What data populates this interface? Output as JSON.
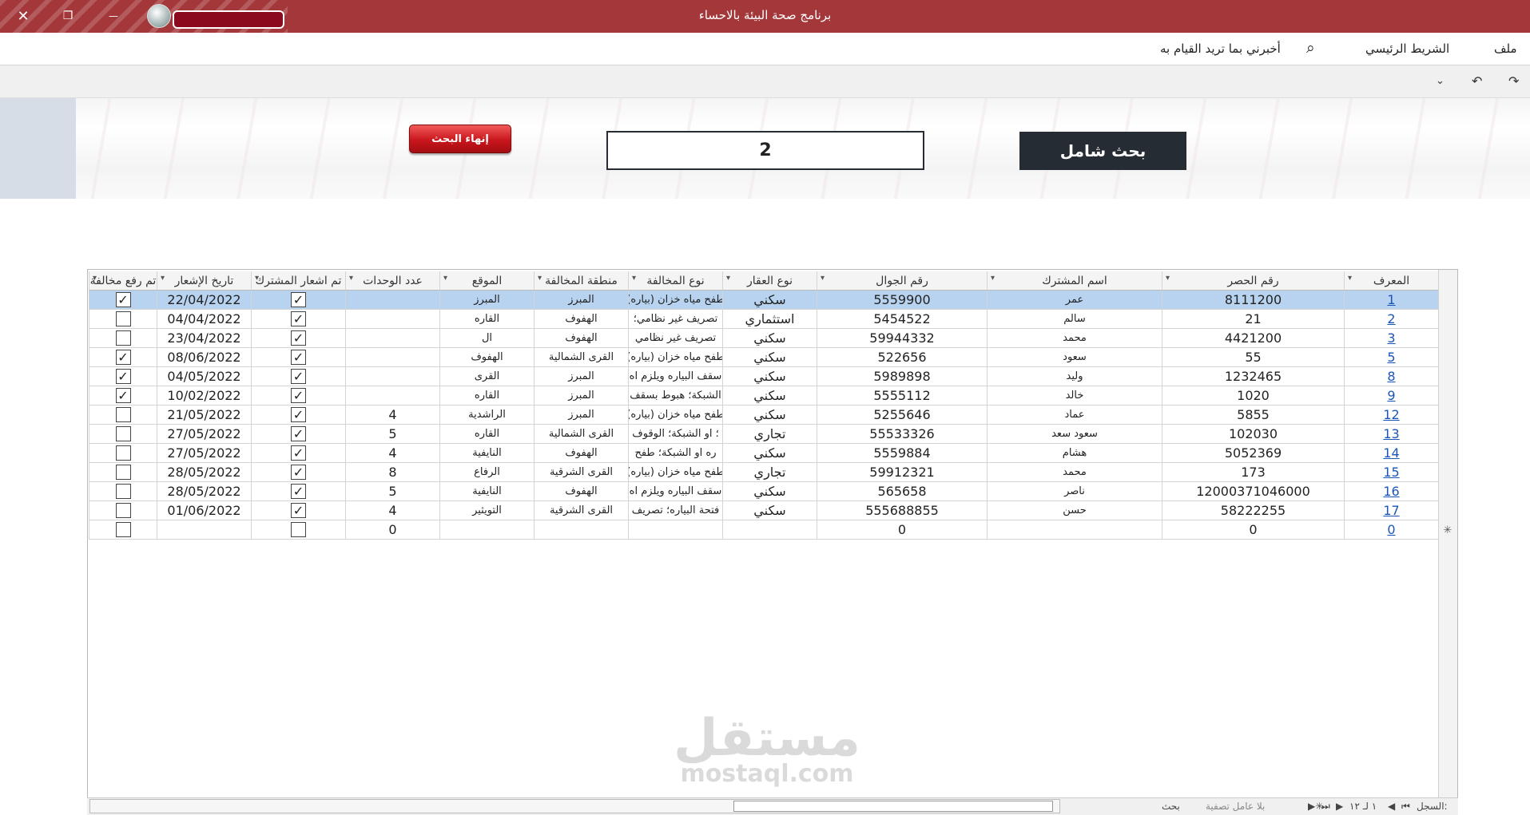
{
  "window": {
    "title": "برنامج صحة البيئة بالاحساء",
    "close_glyph": "✕",
    "restore_glyph": "❐",
    "minimize_glyph": "—"
  },
  "menubar": {
    "file": "ملف",
    "home": "الشريط الرئيسي",
    "tell_me": "أخبرني بما تريد القيام به",
    "search_glyph": "⌕"
  },
  "qat": {
    "redo": "↷",
    "undo": "↶",
    "customize": "⌄"
  },
  "search": {
    "label": "بحث شامل",
    "value": "2",
    "end_button": "إنهاء البحث"
  },
  "table": {
    "columns": [
      "المعرف",
      "رقم الحصر",
      "اسم المشترك",
      "رقم الجوال",
      "نوع العقار",
      "نوع المخالفة",
      "منطقة المخالفة",
      "الموقع",
      "عدد الوحدات",
      "تم اشعار المشترك",
      "تاريخ الإشعار",
      "تم رفع مخالفة"
    ],
    "rows": [
      {
        "id": "1",
        "hasr": "8111200",
        "name": "عمر",
        "mobile": "5559900",
        "prop": "سكني",
        "viol": "طفح مياه خزان (بياره)",
        "area": "المبرز",
        "loc": "المبرز",
        "units": "",
        "notified": "✓",
        "date": "22/04/2022",
        "raised": "✓"
      },
      {
        "id": "2",
        "hasr": "21",
        "name": "سالم",
        "mobile": "5454522",
        "prop": "استثماري",
        "viol": "تصريف غير نظامي؛",
        "area": "الهفوف",
        "loc": "القاره",
        "units": "",
        "notified": "✓",
        "date": "04/04/2022",
        "raised": ""
      },
      {
        "id": "3",
        "hasr": "4421200",
        "name": "محمد",
        "mobile": "59944332",
        "prop": "سكني",
        "viol": "تصريف غير نظامي",
        "area": "الهفوف",
        "loc": "ال",
        "units": "",
        "notified": "✓",
        "date": "23/04/2022",
        "raised": ""
      },
      {
        "id": "5",
        "hasr": "55",
        "name": "سعود",
        "mobile": "522656",
        "prop": "سكني",
        "viol": "طفح مياه خزان (بياره)",
        "area": "القرى الشمالية",
        "loc": "الهفوف",
        "units": "",
        "notified": "✓",
        "date": "08/06/2022",
        "raised": "✓"
      },
      {
        "id": "8",
        "hasr": "1232465",
        "name": "وليد",
        "mobile": "5989898",
        "prop": "سكني",
        "viol": "سقف البياره ويلزم اه",
        "area": "المبرز",
        "loc": "القرى",
        "units": "",
        "notified": "✓",
        "date": "04/05/2022",
        "raised": "✓"
      },
      {
        "id": "9",
        "hasr": "1020",
        "name": "خالد",
        "mobile": "5555112",
        "prop": "سكني",
        "viol": "الشبكة؛ هبوط بسقف",
        "area": "المبرز",
        "loc": "القاره",
        "units": "",
        "notified": "✓",
        "date": "10/02/2022",
        "raised": "✓"
      },
      {
        "id": "12",
        "hasr": "5855",
        "name": "عماد",
        "mobile": "5255646",
        "prop": "سكني",
        "viol": "طفح مياه خزان (بياره)",
        "area": "المبرز",
        "loc": "الراشدية",
        "units": "4",
        "notified": "✓",
        "date": "21/05/2022",
        "raised": ""
      },
      {
        "id": "13",
        "hasr": "102030",
        "name": "سعود سعد",
        "mobile": "55533326",
        "prop": "تجاري",
        "viol": "؛ او الشبكة؛ الوقوف",
        "area": "القرى الشمالية",
        "loc": "القاره",
        "units": "5",
        "notified": "✓",
        "date": "27/05/2022",
        "raised": ""
      },
      {
        "id": "14",
        "hasr": "5052369",
        "name": "هشام",
        "mobile": "5559884",
        "prop": "سكني",
        "viol": "ره او الشبكة؛ طفح",
        "area": "الهفوف",
        "loc": "النايفية",
        "units": "4",
        "notified": "✓",
        "date": "27/05/2022",
        "raised": ""
      },
      {
        "id": "15",
        "hasr": "173",
        "name": "محمد",
        "mobile": "59912321",
        "prop": "تجاري",
        "viol": "طفح مياه خزان (بياره)",
        "area": "القرى الشرقية",
        "loc": "الرفاع",
        "units": "8",
        "notified": "✓",
        "date": "28/05/2022",
        "raised": ""
      },
      {
        "id": "16",
        "hasr": "12000371046000",
        "name": "ناصر",
        "mobile": "565658",
        "prop": "سكني",
        "viol": "سقف البياره ويلزم اه",
        "area": "الهفوف",
        "loc": "النايفية",
        "units": "5",
        "notified": "✓",
        "date": "28/05/2022",
        "raised": ""
      },
      {
        "id": "17",
        "hasr": "58222255",
        "name": "حسن",
        "mobile": "555688855",
        "prop": "سكني",
        "viol": "فتحة البياره؛ تصريف",
        "area": "القرى الشرقية",
        "loc": "التويثير",
        "units": "4",
        "notified": "✓",
        "date": "01/06/2022",
        "raised": ""
      }
    ],
    "new_row": {
      "id": "0",
      "hasr": "0",
      "name": "",
      "mobile": "0",
      "prop": "",
      "viol": "",
      "area": "",
      "loc": "",
      "units": "0",
      "notified": "",
      "date": "",
      "raised": ""
    },
    "new_row_marker": "✳"
  },
  "statusbar": {
    "record_label": "السجل:",
    "record_of": "١ لـ ١٢",
    "filter": "بلا عامل تصفية",
    "search": "بحث"
  },
  "watermark": {
    "ar": "مستقل",
    "en": "mostaql.com"
  }
}
